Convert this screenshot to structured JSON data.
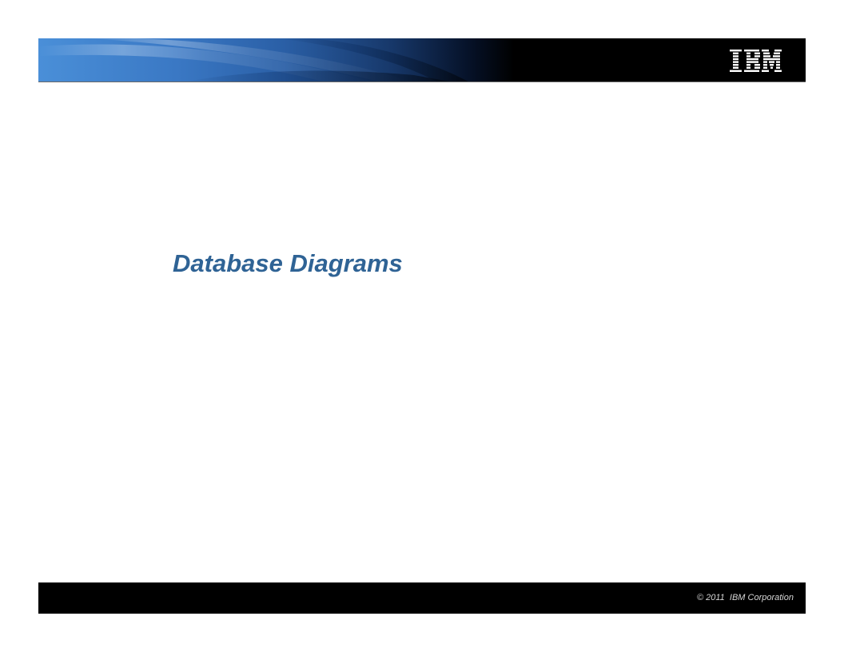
{
  "header": {
    "logo_text": "IBM",
    "logo_icon": "ibm-striped-logo-icon"
  },
  "slide": {
    "title": "Database Diagrams"
  },
  "footer": {
    "copyright": "© 2011  IBM Corporation"
  },
  "colors": {
    "title": "#2f6395",
    "header_gradient_start": "#4a8fd8",
    "header_dark": "#000000",
    "footer": "#000000",
    "footer_text": "#d6d6d6",
    "logo": "#ffffff"
  }
}
